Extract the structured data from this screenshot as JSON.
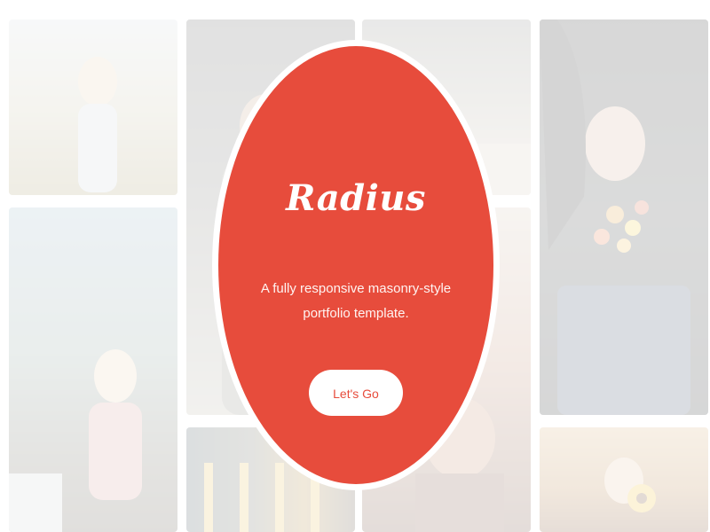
{
  "hero": {
    "title": "Radius",
    "subtitle": "A fully responsive masonry-style portfolio template.",
    "cta_label": "Let's Go"
  },
  "colors": {
    "accent": "#e74c3c",
    "background": "#ffffff",
    "button_bg": "#ffffff",
    "button_text": "#e74c3c"
  },
  "gallery": {
    "tiles": [
      {
        "name": "gallery-photo-1",
        "subject": "woman in field"
      },
      {
        "name": "gallery-photo-2",
        "subject": "woman seated outdoors"
      },
      {
        "name": "gallery-photo-3",
        "subject": "person portrait"
      },
      {
        "name": "gallery-photo-4",
        "subject": "street scene"
      },
      {
        "name": "gallery-photo-5",
        "subject": "landscape"
      },
      {
        "name": "gallery-photo-6",
        "subject": "woman portrait"
      },
      {
        "name": "gallery-photo-7",
        "subject": "woman smelling flowers"
      },
      {
        "name": "gallery-photo-8",
        "subject": "woman with sunflower"
      }
    ]
  }
}
